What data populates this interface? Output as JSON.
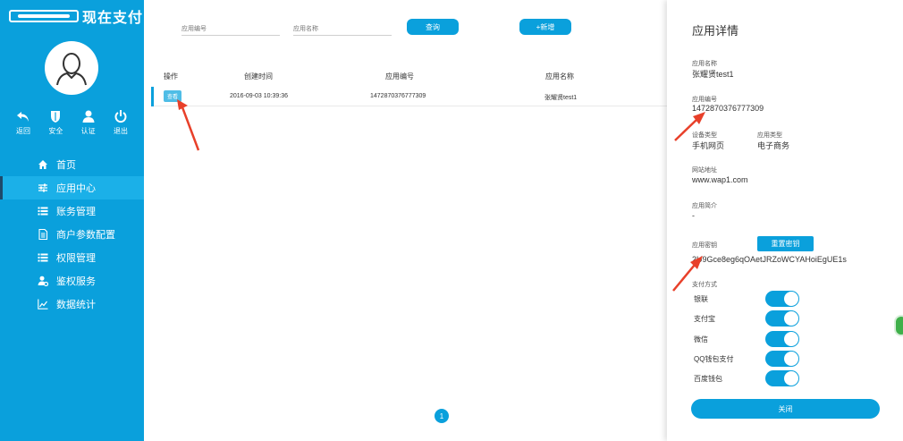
{
  "brand": {
    "name": "现在支付"
  },
  "quick_actions": [
    {
      "label": "返回",
      "icon": "back-icon"
    },
    {
      "label": "安全",
      "icon": "shield-icon"
    },
    {
      "label": "认证",
      "icon": "user-icon"
    },
    {
      "label": "退出",
      "icon": "power-icon"
    }
  ],
  "nav": [
    {
      "label": "首页",
      "icon": "home-icon"
    },
    {
      "label": "应用中心",
      "icon": "sliders-icon",
      "active": true
    },
    {
      "label": "账务管理",
      "icon": "list-icon"
    },
    {
      "label": "商户参数配置",
      "icon": "document-icon"
    },
    {
      "label": "权限管理",
      "icon": "list-icon"
    },
    {
      "label": "鉴权服务",
      "icon": "user-gear-icon"
    },
    {
      "label": "数据统计",
      "icon": "line-chart-icon"
    }
  ],
  "search": {
    "app_id_placeholder": "应用编号",
    "app_name_placeholder": "应用名称",
    "query_label": "查询",
    "add_label": "+新增"
  },
  "table": {
    "headers": {
      "action": "操作",
      "created": "创建时间",
      "app_id": "应用编号",
      "app_name": "应用名称"
    },
    "rows": [
      {
        "action": "查看",
        "created": "2016-09-03 10:39:36",
        "app_id": "1472870376777309",
        "app_name": "张耀贤test1"
      }
    ]
  },
  "pagination": {
    "current": "1"
  },
  "detail": {
    "title": "应用详情",
    "app_name_label": "应用名称",
    "app_name": "张耀贤test1",
    "app_id_label": "应用编号",
    "app_id": "1472870376777309",
    "device_type_label": "设备类型",
    "device_type": "手机网页",
    "app_type_label": "应用类型",
    "app_type": "电子商务",
    "website_label": "网站地址",
    "website": "www.wap1.com",
    "intro_label": "应用简介",
    "intro": "-",
    "secret_label": "应用密钥",
    "reset_label": "重置密钥",
    "secret": "2U9Gce8eg6qOAetJRZoWCYAHoiEgUE1s",
    "pay_methods_label": "支付方式",
    "pay_methods": [
      {
        "label": "银联",
        "enabled": true
      },
      {
        "label": "支付宝",
        "enabled": true
      },
      {
        "label": "微信",
        "enabled": true
      },
      {
        "label": "QQ钱包支付",
        "enabled": true
      },
      {
        "label": "百度钱包",
        "enabled": true
      }
    ],
    "close_label": "关闭"
  },
  "colors": {
    "primary": "#0aa0dc",
    "annotation": "#e8402a"
  }
}
